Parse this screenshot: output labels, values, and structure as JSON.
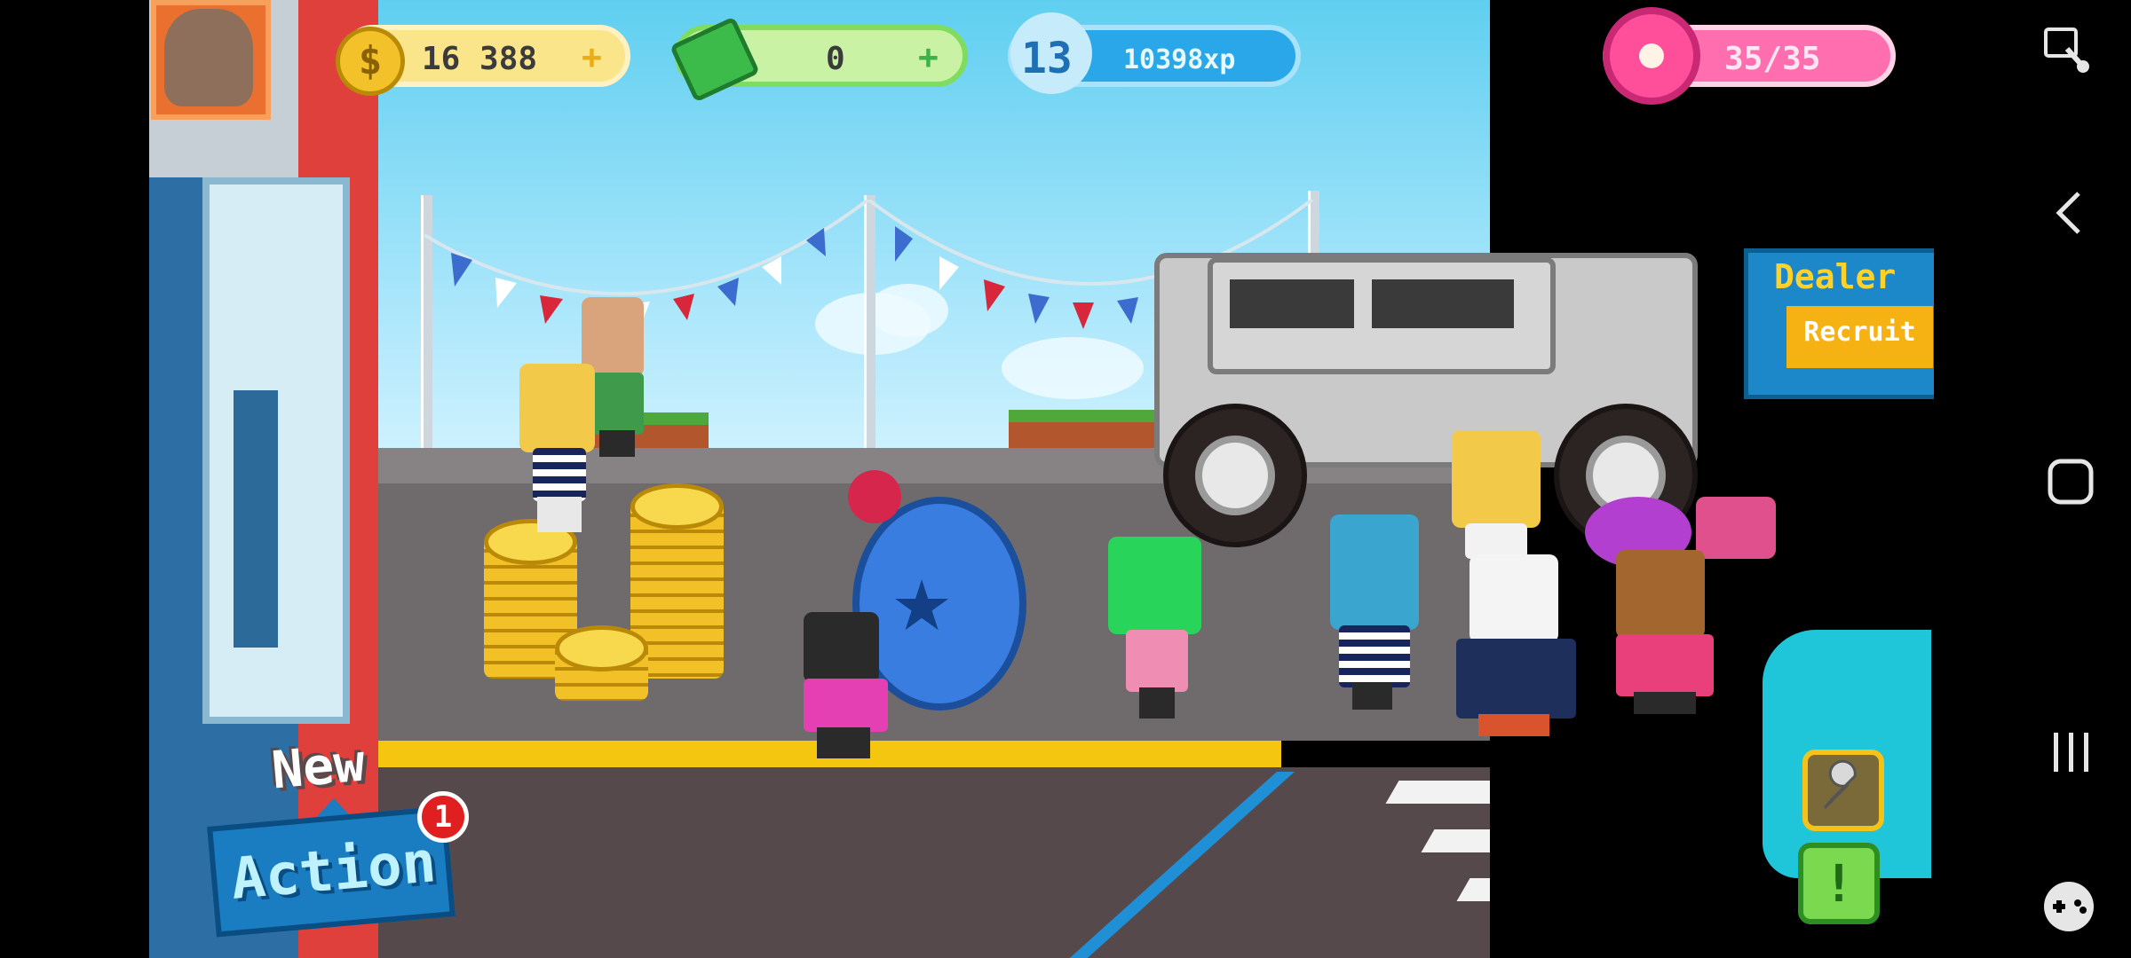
{
  "hud": {
    "coins": "16 388",
    "cash": "0",
    "level": "13",
    "xp": "10398xp",
    "energy": "35/35"
  },
  "dealer": {
    "title": "Dealer",
    "button": "Recruit"
  },
  "new_action": {
    "new_label": "New",
    "button_label": "Action",
    "badge_count": "1"
  },
  "icons": {
    "coin": "dollar-coin-icon",
    "cash": "cash-bundle-icon",
    "level": "level-star-icon",
    "energy": "donut-icon",
    "tool": "wrench-icon",
    "alert": "exclamation-icon",
    "nav": [
      "screenshot-icon",
      "back-icon",
      "home-icon",
      "recents-icon",
      "game-launcher-icon"
    ]
  },
  "colors": {
    "coin_bar": "#f7e06b",
    "cash_bar": "#8be06b",
    "xp_bar": "#2aa7e8",
    "energy_bar": "#ff5fa8"
  }
}
